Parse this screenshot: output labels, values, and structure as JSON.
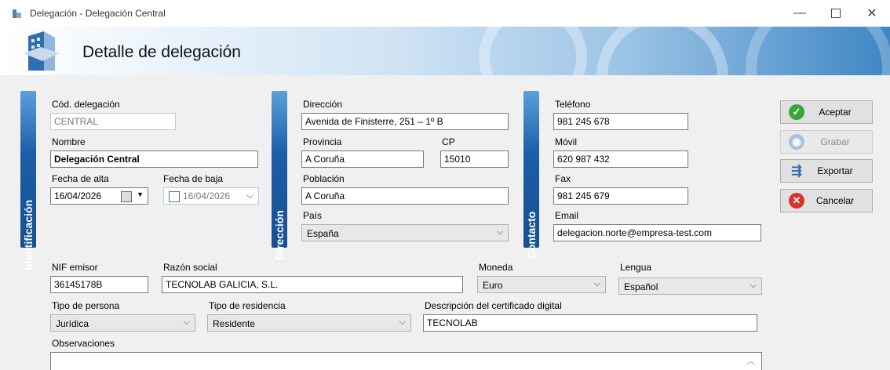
{
  "window": {
    "title": "Delegación - Delegación Central"
  },
  "header": {
    "title": "Detalle de delegación"
  },
  "sections": {
    "identificacion": "Identificación",
    "direccion": "Dirección",
    "contacto": "Contacto"
  },
  "identificacion": {
    "cod_label": "Cód. delegación",
    "cod_value": "CENTRAL",
    "nombre_label": "Nombre",
    "nombre_value": "Delegación Central",
    "fecha_alta_label": "Fecha de alta",
    "fecha_alta_value": "16/04/2026",
    "fecha_baja_label": "Fecha de baja",
    "fecha_baja_value": "16/04/2026"
  },
  "direccion": {
    "direccion_label": "Dirección",
    "direccion_value": "Avenida de Finisterre, 251 – 1º B",
    "provincia_label": "Provincia",
    "provincia_value": "A Coruña",
    "cp_label": "CP",
    "cp_value": "15010",
    "poblacion_label": "Población",
    "poblacion_value": "A Coruña",
    "pais_label": "País",
    "pais_value": "España"
  },
  "contacto": {
    "telefono_label": "Teléfono",
    "telefono_value": "981 245 678",
    "movil_label": "Móvil",
    "movil_value": "620 987 432",
    "fax_label": "Fax",
    "fax_value": "981 245 679",
    "email_label": "Email",
    "email_value": "delegacion.norte@empresa-test.com"
  },
  "fiscal": {
    "nif_label": "NIF emisor",
    "nif_value": "36145178B",
    "razon_label": "Razón social",
    "razon_value": "TECNOLAB GALICIA, S.L.",
    "moneda_label": "Moneda",
    "moneda_value": "Euro",
    "lengua_label": "Lengua",
    "lengua_value": "Español",
    "tipo_persona_label": "Tipo de persona",
    "tipo_persona_value": "Jurídica",
    "tipo_residencia_label": "Tipo de residencia",
    "tipo_residencia_value": "Residente",
    "cert_label": "Descripción del certificado digital",
    "cert_value": "TECNOLAB",
    "obs_label": "Observaciones",
    "obs_value": ""
  },
  "buttons": {
    "aceptar": "Aceptar",
    "grabar": "Grabar",
    "exportar": "Exportar",
    "cancelar": "Cancelar"
  },
  "colors": {
    "accent": "#1c5ea8",
    "ok": "#3aa53a",
    "cancel": "#d9342b"
  }
}
